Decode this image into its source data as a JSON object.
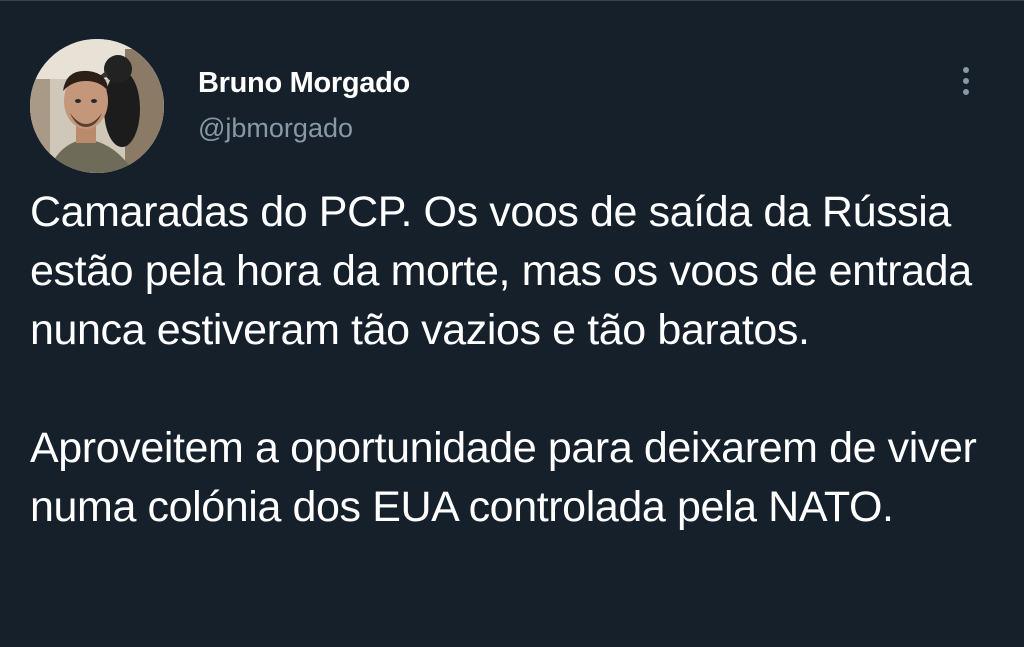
{
  "tweet": {
    "author": {
      "display_name": "Bruno Morgado",
      "handle": "@jbmorgado"
    },
    "paragraphs": [
      "Camaradas do PCP. Os voos de saída da Rússia estão pela hora da morte, mas os voos de entrada nunca estiveram tão vazios e tão baratos.",
      "Aproveitem a oportunidade para deixarem de viver numa colónia dos EUA controlada pela NATO."
    ],
    "more_icon": "more-vertical-icon"
  },
  "colors": {
    "background": "#15202b",
    "text_primary": "#ffffff",
    "text_secondary": "#8899a6"
  }
}
